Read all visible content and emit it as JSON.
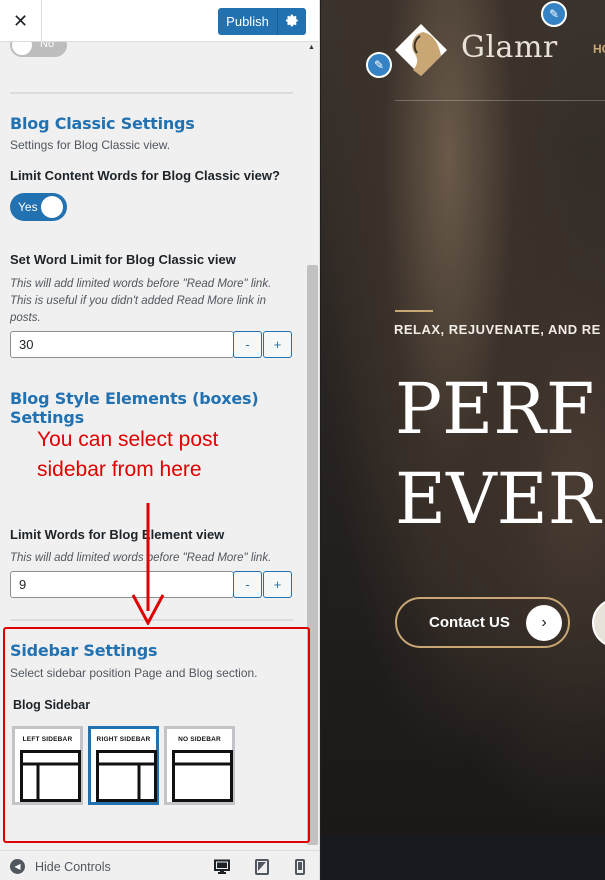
{
  "topbar": {
    "close_glyph": "✕",
    "publish_label": "Publish",
    "settings_icon": "gear-icon"
  },
  "panel": {
    "prev_toggle": {
      "label": "No",
      "checked": false
    },
    "blog_classic": {
      "title": "Blog Classic Settings",
      "description": "Settings for Blog Classic view.",
      "limit_words_label": "Limit Content Words for Blog Classic view?",
      "limit_words_toggle": {
        "label": "Yes",
        "checked": true
      },
      "word_limit_label": "Set Word Limit for Blog Classic view",
      "word_limit_help": "This will add limited words before \"Read More\" link. This is useful if you didn't added Read More link in posts.",
      "word_limit_value": "30",
      "minus": "-",
      "plus": "+"
    },
    "blog_elements": {
      "title": "Blog Style Elements (boxes) Settings",
      "limit_label": "Limit Words for Blog Element view",
      "limit_help": "This will add limited words before \"Read More\" link.",
      "limit_value": "9",
      "minus": "-",
      "plus": "+"
    },
    "annotation": "You can select post sidebar from here",
    "sidebar": {
      "title": "Sidebar Settings",
      "description": "Select sidebar position Page and Blog section.",
      "blog_sidebar_label": "Blog Sidebar",
      "options": [
        {
          "caption": "LEFT SIDEBAR",
          "selected": false
        },
        {
          "caption": "RIGHT SIDEBAR",
          "selected": true
        },
        {
          "caption": "NO SIDEBAR",
          "selected": false
        }
      ]
    }
  },
  "bottombar": {
    "hide_controls": "Hide Controls",
    "devices": [
      "desktop-icon",
      "tablet-icon",
      "mobile-icon"
    ]
  },
  "preview": {
    "logo_text": "Glamr",
    "nav_partial": "HO",
    "tagline": "RELAX, REJUVENATE, AND RE",
    "headline_line1": "PERF",
    "headline_line2": "EVER",
    "cta_label": "Contact US"
  },
  "colors": {
    "accent": "#2271b1",
    "annotation": "#e00000",
    "gold": "#c8a774"
  }
}
